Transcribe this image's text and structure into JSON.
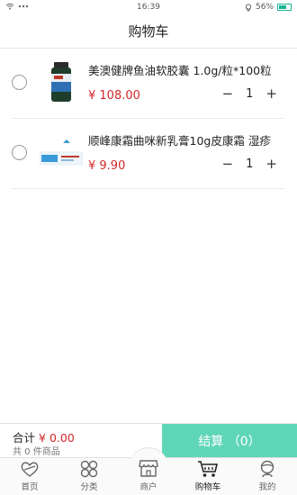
{
  "status_bar": {
    "time": "16:39",
    "battery": "56%"
  },
  "header": {
    "title": "购物车"
  },
  "cart": {
    "items": [
      {
        "title": "美澳健牌鱼油软胶囊 1.0g/粒*100粒",
        "price": "¥ 108.00",
        "quantity": "1",
        "minus": "−",
        "plus": "+"
      },
      {
        "title": "顺峰康霜曲咪新乳膏10g皮康霜 湿疹",
        "price": "¥ 9.90",
        "quantity": "1",
        "minus": "−",
        "plus": "+"
      }
    ]
  },
  "checkout": {
    "total_label": "合计",
    "total_amount": "¥ 0.00",
    "count_text": "共 0 件商品",
    "pay_label": "结算 （0）"
  },
  "tabs": [
    {
      "label": "首页",
      "icon": "home-icon"
    },
    {
      "label": "分类",
      "icon": "category-icon"
    },
    {
      "label": "商户",
      "icon": "merchant-icon"
    },
    {
      "label": "购物车",
      "icon": "cart-icon"
    },
    {
      "label": "我的",
      "icon": "profile-icon"
    }
  ],
  "colors": {
    "accent": "#5fd6b8",
    "price": "#d2282c"
  }
}
